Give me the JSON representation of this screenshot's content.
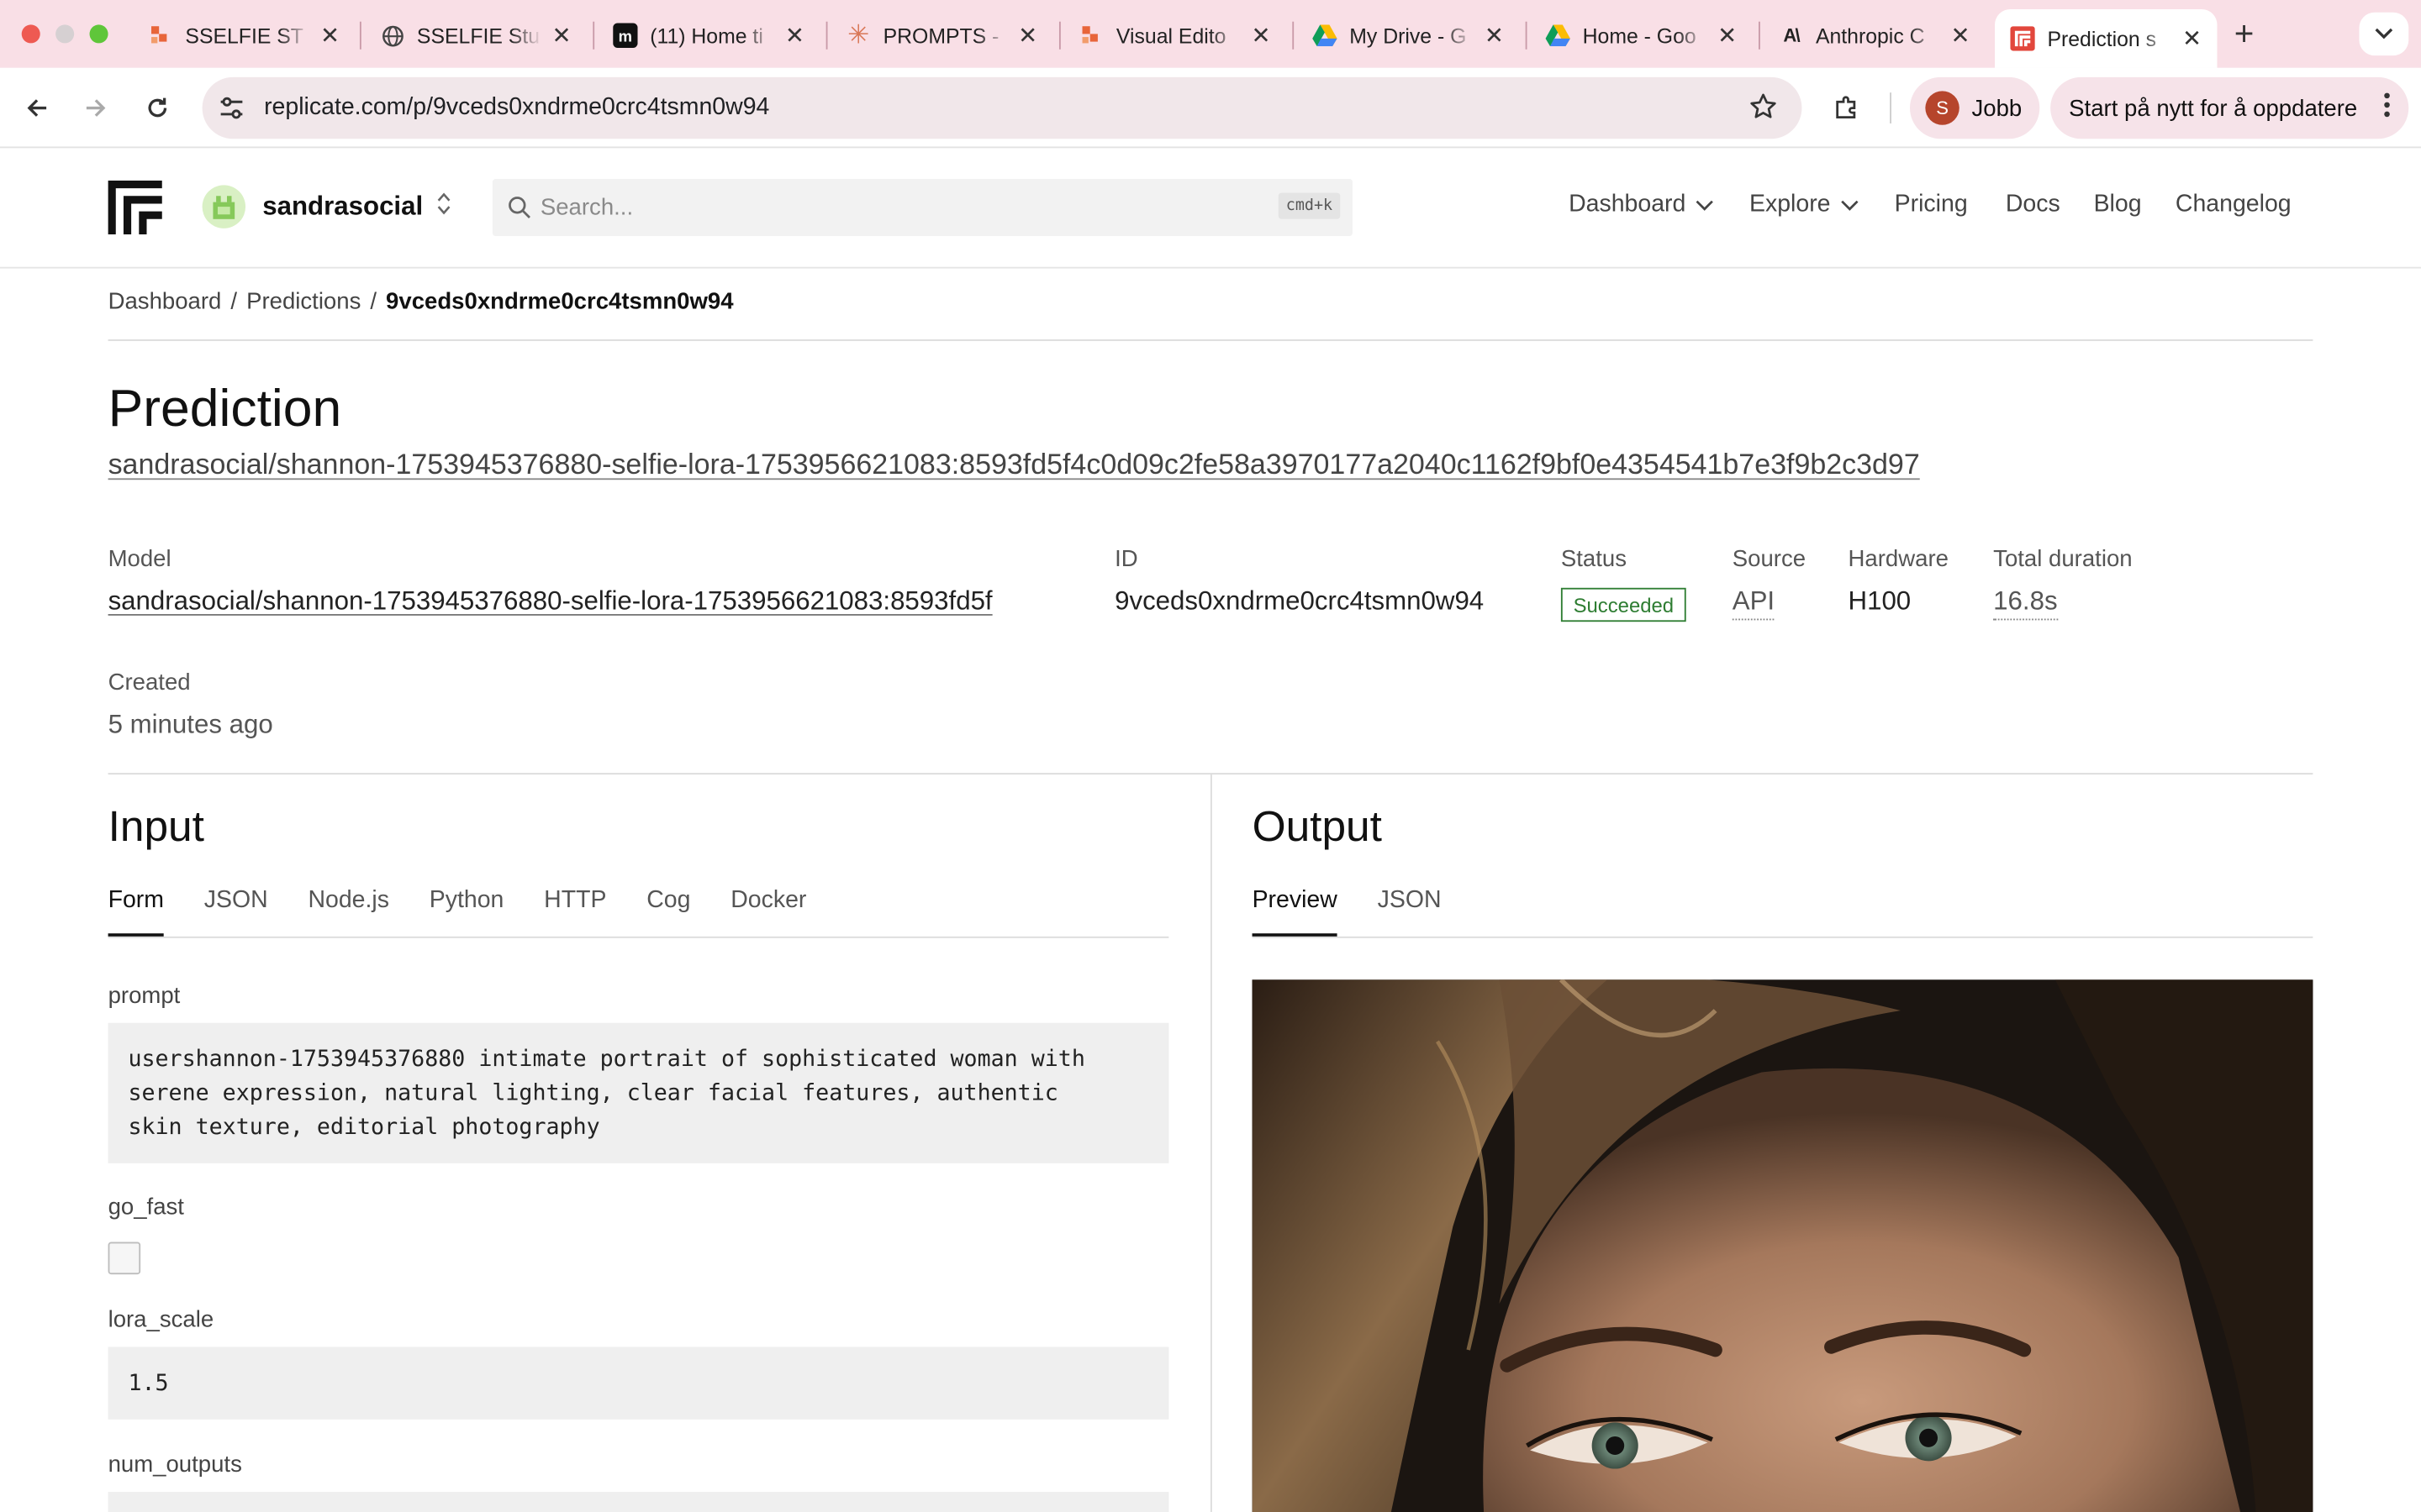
{
  "browser": {
    "tabs": [
      {
        "title": "SSELFIE ST",
        "icon": "replicate-orange-icon"
      },
      {
        "title": "SSELFIE Stu",
        "icon": "globe-icon"
      },
      {
        "title": "(11) Home ti",
        "icon": "monday-icon"
      },
      {
        "title": "PROMPTS -",
        "icon": "claude-star-icon"
      },
      {
        "title": "Visual Edito",
        "icon": "replicate-orange-icon"
      },
      {
        "title": "My Drive - G",
        "icon": "google-drive-icon"
      },
      {
        "title": "Home - Goo",
        "icon": "google-drive-icon"
      },
      {
        "title": "Anthropic C",
        "icon": "anthropic-icon"
      },
      {
        "title": "Prediction s",
        "icon": "replicate-icon",
        "active": true
      }
    ],
    "url": "replicate.com/p/9vceds0xndrme0crc4tsmn0w94",
    "profile_initial": "S",
    "profile_label": "Jobb",
    "update_label": "Start på nytt for å oppdatere"
  },
  "header": {
    "account": "sandrasocial",
    "search_placeholder": "Search...",
    "search_shortcut": "cmd+k",
    "nav": [
      "Dashboard",
      "Explore",
      "Pricing",
      "Docs",
      "Blog",
      "Changelog"
    ]
  },
  "breadcrumb": {
    "items": [
      "Dashboard",
      "Predictions"
    ],
    "sep": "/",
    "current": "9vceds0xndrme0crc4tsmn0w94"
  },
  "prediction": {
    "title": "Prediction",
    "version": "sandrasocial/shannon-1753945376880-selfie-lora-1753956621083:8593fd5f4c0d09c2fe58a3970177a2040c1162f9bf0e4354541b7e3f9b2c3d97",
    "meta": {
      "model_label": "Model",
      "model_value": "sandrasocial/shannon-1753945376880-selfie-lora-1753956621083:8593fd5f",
      "id_label": "ID",
      "id_value": "9vceds0xndrme0crc4tsmn0w94",
      "status_label": "Status",
      "status_value": "Succeeded",
      "source_label": "Source",
      "source_value": "API",
      "hardware_label": "Hardware",
      "hardware_value": "H100",
      "duration_label": "Total duration",
      "duration_value": "16.8s",
      "created_label": "Created",
      "created_value": "5 minutes ago"
    }
  },
  "input": {
    "title": "Input",
    "tabs": [
      "Form",
      "JSON",
      "Node.js",
      "Python",
      "HTTP",
      "Cog",
      "Docker"
    ],
    "fields": {
      "prompt_label": "prompt",
      "prompt_lines": [
        "usershannon-1753945376880 intimate portrait of sophisticated woman with",
        "serene expression, natural lighting, clear facial features, authentic",
        "skin texture, editorial photography"
      ],
      "go_fast_label": "go_fast",
      "lora_scale_label": "lora_scale",
      "lora_scale_value": "1.5",
      "num_outputs_label": "num_outputs"
    }
  },
  "output": {
    "title": "Output",
    "tabs": [
      "Preview",
      "JSON"
    ]
  },
  "colors": {
    "tabstrip": "#f9dfe6",
    "status_green": "#2e7d32"
  }
}
